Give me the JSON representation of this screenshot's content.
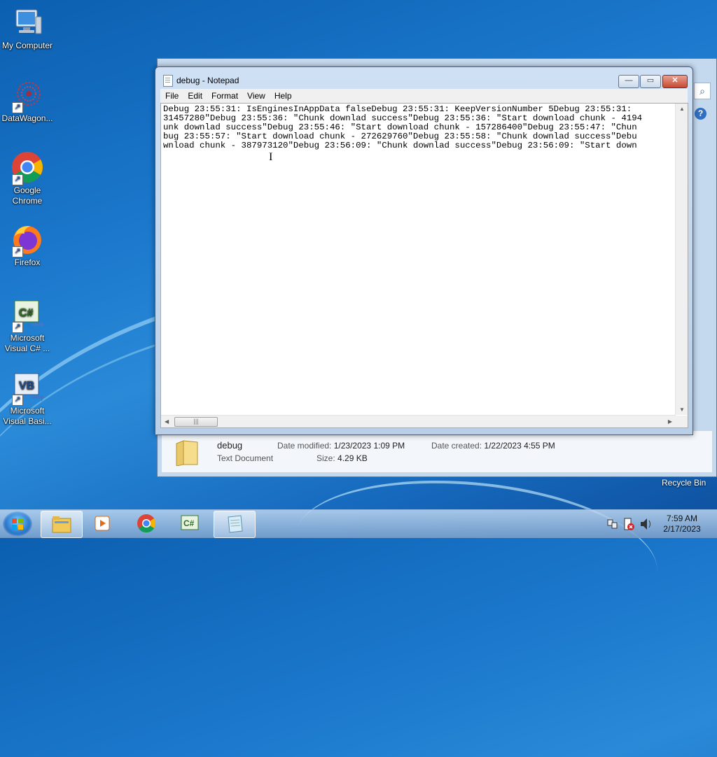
{
  "desktop": {
    "icons": [
      {
        "label": "My Computer"
      },
      {
        "label": "DataWagon..."
      },
      {
        "label": "Google Chrome"
      },
      {
        "label": "Firefox"
      },
      {
        "label": "Microsoft Visual C# ..."
      },
      {
        "label": "Microsoft Visual Basi..."
      }
    ],
    "recycle_bin": "Recycle Bin"
  },
  "notepad": {
    "title": "debug - Notepad",
    "menu": [
      "File",
      "Edit",
      "Format",
      "View",
      "Help"
    ],
    "content_lines": [
      "Debug 23:55:31: IsEnginesInAppData falseDebug 23:55:31: KeepVersionNumber 5Debug 23:55:31:",
      "31457280\"Debug 23:55:36: \"Chunk downlad success\"Debug 23:55:36: \"Start download chunk - 4194",
      "unk downlad success\"Debug 23:55:46: \"Start download chunk - 157286400\"Debug 23:55:47: \"Chun",
      "bug 23:55:57: \"Start download chunk - 272629760\"Debug 23:55:58: \"Chunk downlad success\"Debu",
      "wnload chunk - 387973120\"Debug 23:56:09: \"Chunk downlad success\"Debug 23:56:09: \"Start down"
    ],
    "minimize_label": "—",
    "maximize_label": "▭",
    "close_label": "✕"
  },
  "file_details": {
    "name": "debug",
    "type": "Text Document",
    "date_modified_label": "Date modified:",
    "date_modified": "1/23/2023 1:09 PM",
    "date_created_label": "Date created:",
    "date_created": "1/22/2023 4:55 PM",
    "size_label": "Size:",
    "size": "4.29 KB"
  },
  "taskbar": {
    "time": "7:59 AM",
    "date": "2/17/2023",
    "apps": [
      "explorer",
      "media-player",
      "chrome",
      "visual-csharp",
      "notepad"
    ]
  }
}
